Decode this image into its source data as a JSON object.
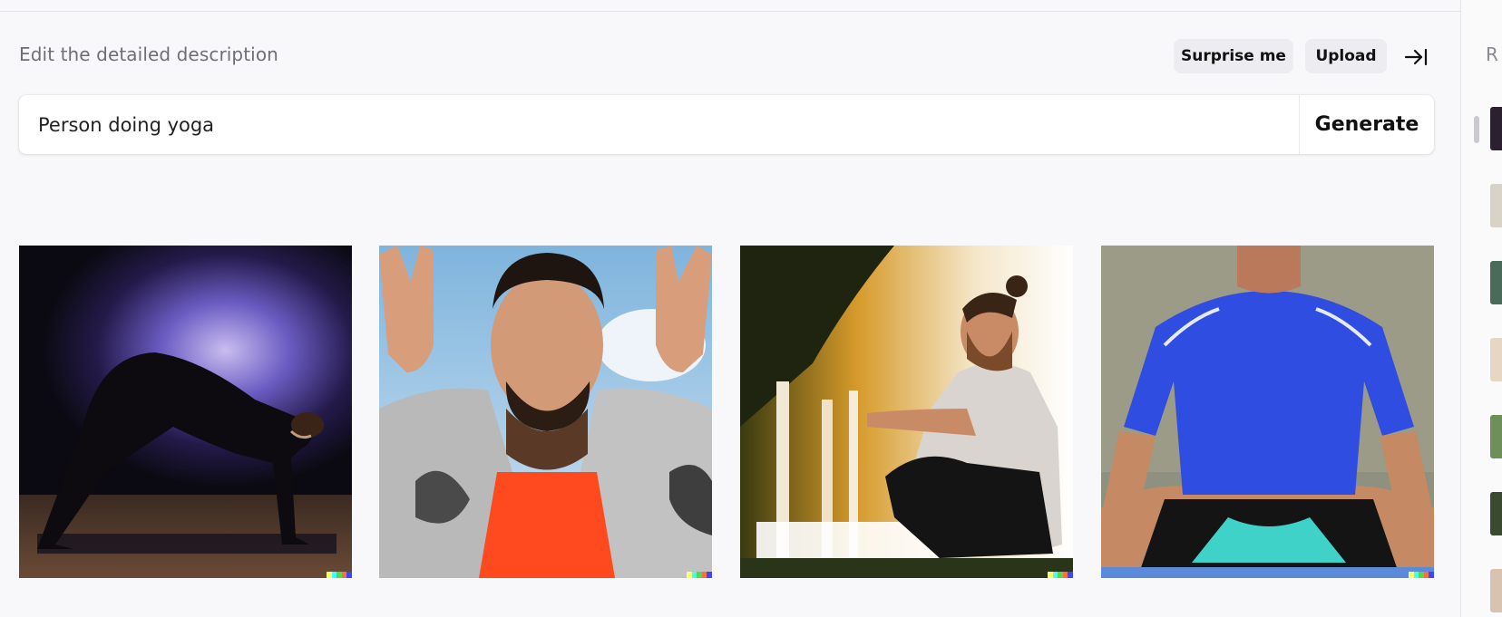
{
  "header": {
    "heading": "Edit the detailed description",
    "surprise_label": "Surprise me",
    "upload_label": "Upload",
    "collapse_icon": "arrow-right-to-bar-icon"
  },
  "prompt": {
    "value": "Person doing yoga",
    "generate_label": "Generate"
  },
  "results": [
    {
      "description": "Woman in downward dog pose against purple backdrop"
    },
    {
      "description": "Bearded man in grey blazer and red shirt, hands raised"
    },
    {
      "description": "Bearded man with man-bun stretching outdoors"
    },
    {
      "description": "Man in blue shirt sitting cross-legged"
    }
  ],
  "sidebar": {
    "label": "R"
  },
  "colors": {
    "background": "#f8f8fa",
    "pill": "#ececf1",
    "badge": [
      "#ffff66",
      "#42ffff",
      "#51da4c",
      "#ff6e3c",
      "#3c46ff"
    ]
  }
}
